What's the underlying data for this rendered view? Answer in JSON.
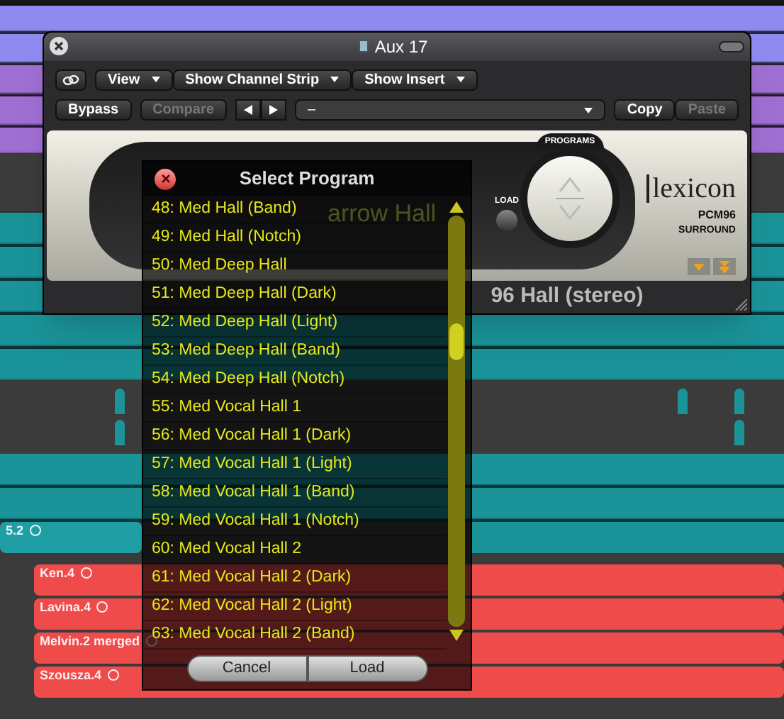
{
  "window": {
    "title": "Aux 17"
  },
  "toolbar": {
    "view": "View",
    "show_channel_strip": "Show Channel Strip",
    "show_insert": "Show Insert"
  },
  "controls": {
    "bypass": "Bypass",
    "compare": {
      "label": "Compare",
      "disabled": true
    },
    "preset": "–",
    "copy": "Copy",
    "paste": {
      "label": "Paste",
      "disabled": true
    }
  },
  "plugin": {
    "programs_label": "PROGRAMS",
    "load_label": "LOAD",
    "brand": "lexicon",
    "model": "PCM96",
    "edition": "SURROUND",
    "display_line_1": "arrow Hall",
    "display_line_2": "96 Hall (stereo)"
  },
  "dialog": {
    "title": "Select Program",
    "items": [
      "48: Med Hall (Band)",
      "49: Med Hall (Notch)",
      "50: Med Deep Hall",
      "51: Med Deep Hall (Dark)",
      "52: Med Deep Hall (Light)",
      "53: Med Deep Hall (Band)",
      "54: Med Deep Hall (Notch)",
      "55: Med Vocal Hall 1",
      "56: Med Vocal Hall 1 (Dark)",
      "57: Med Vocal Hall 1 (Light)",
      "58: Med Vocal Hall 1 (Band)",
      "59: Med Vocal Hall 1 (Notch)",
      "60: Med Vocal Hall 2",
      "61: Med Vocal Hall 2 (Dark)",
      "62: Med Vocal Hall 2 (Light)",
      "63: Med Vocal Hall 2 (Band)"
    ],
    "buttons": [
      "Cancel",
      "Load"
    ]
  },
  "regions": [
    {
      "label": "5.2",
      "color": "#1f9ea3"
    },
    {
      "label": "Ken.4",
      "color": "#ef4b4b"
    },
    {
      "label": "Lavina.4",
      "color": "#ef4b4b"
    },
    {
      "label": "Melvin.2 merged",
      "color": "#ef4b4b"
    },
    {
      "label": "Szousza.4",
      "color": "#ef4b4b"
    }
  ]
}
